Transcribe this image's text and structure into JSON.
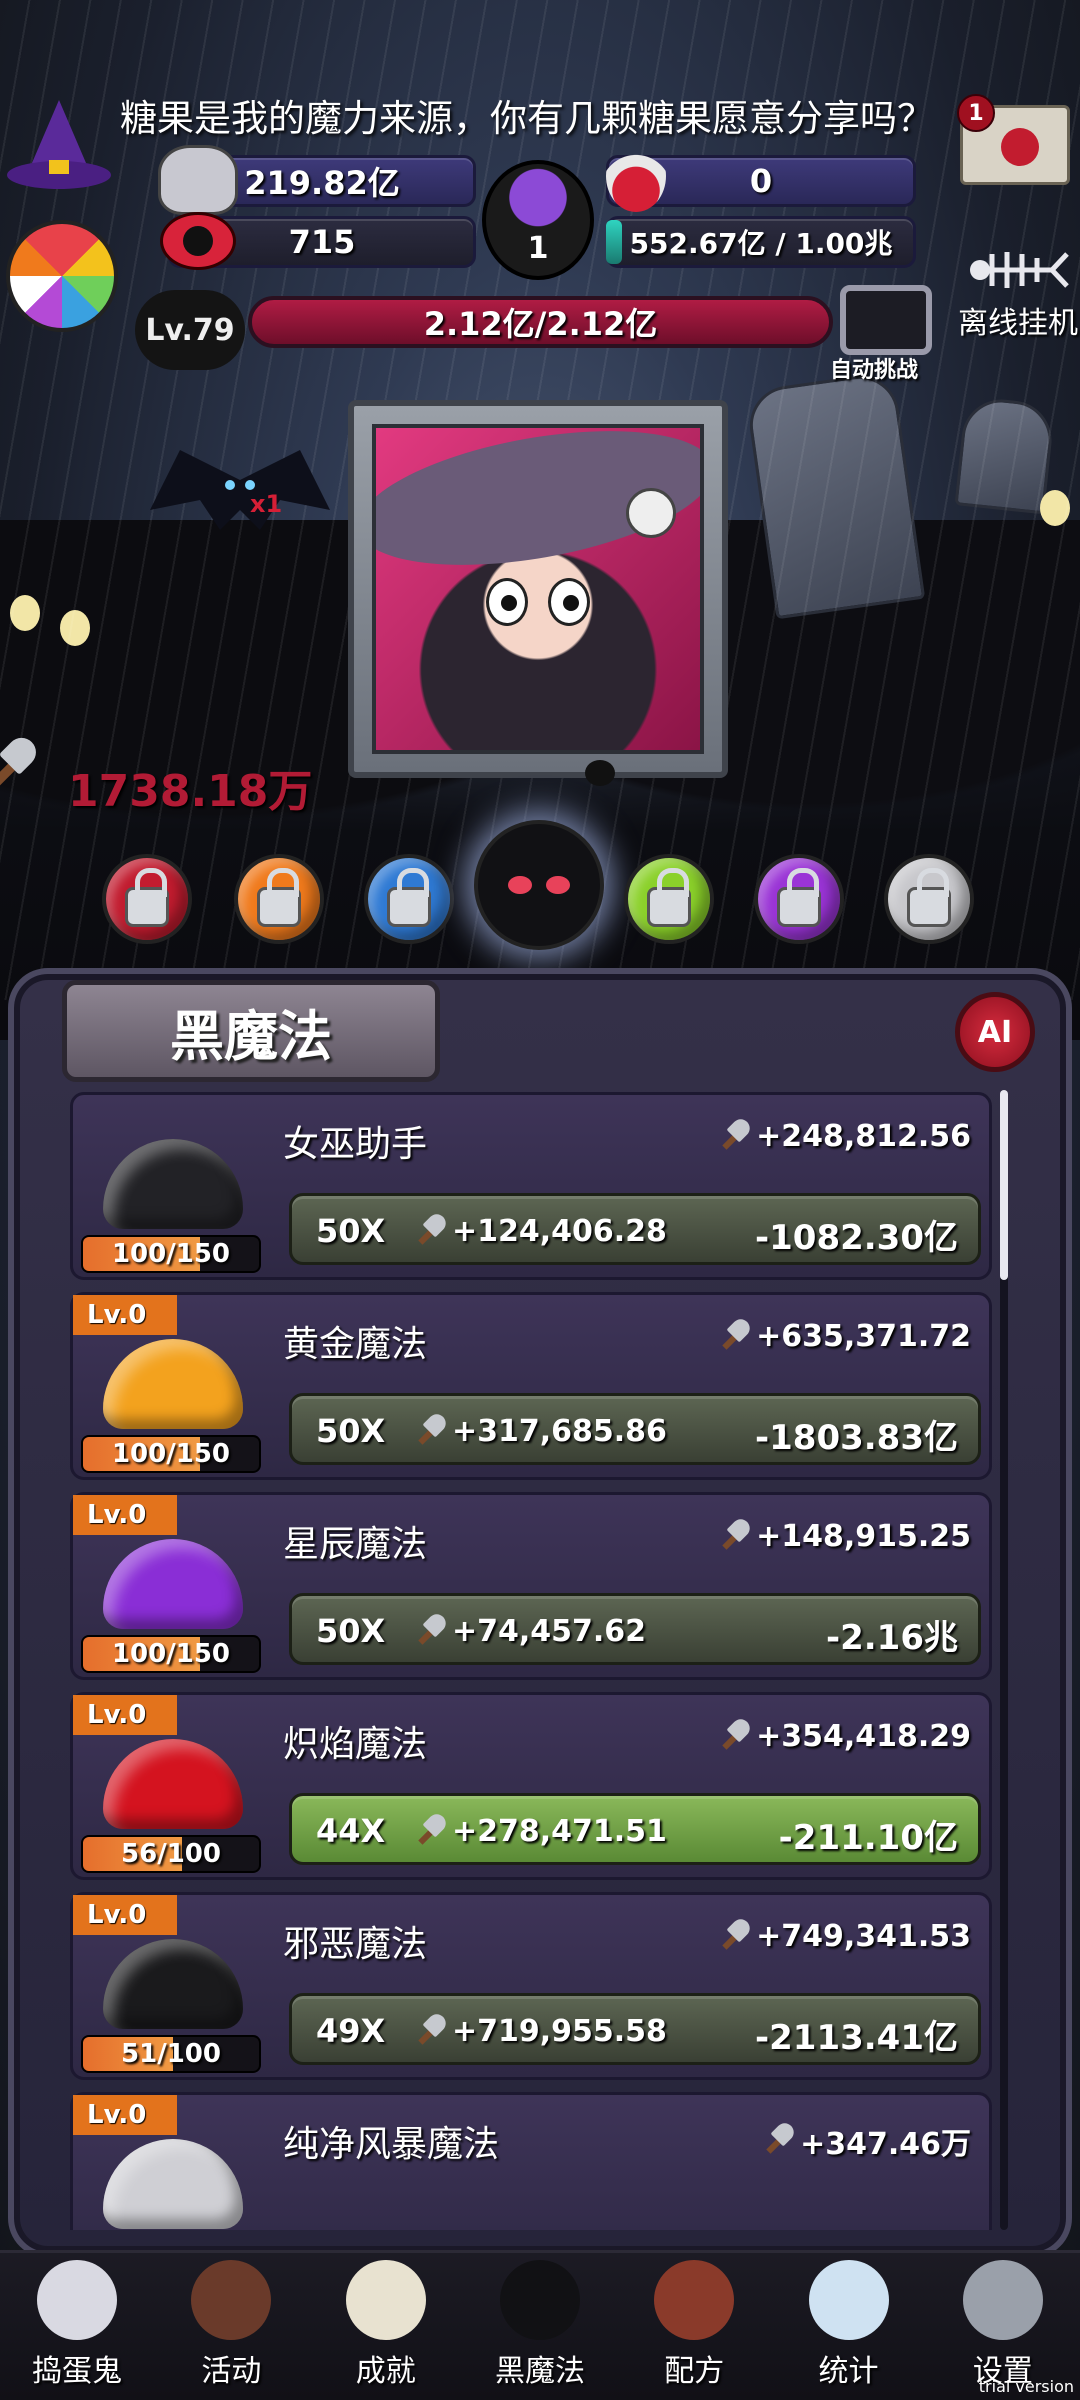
{
  "header": {
    "quest_text": "糖果是我的魔力来源，你有几颗糖果愿意分享吗？",
    "mail_count": "1",
    "candy_amount": "219.82亿",
    "ghost_amount": "0",
    "skull_amount": "715",
    "cauldron_count": "1",
    "potion_amount": "552.67亿 / 1.00兆",
    "level": "Lv.79",
    "hp": "2.12亿/2.12亿",
    "hp_fraction": 1.0,
    "auto_challenge": "自动挑战",
    "offline": "离线挂机"
  },
  "scene": {
    "damage": "1738.18万",
    "bat_multiplier": "x1"
  },
  "panel": {
    "title": "黑魔法",
    "ai_label": "AI"
  },
  "items": [
    {
      "name": "女巫助手",
      "lv": "",
      "progress": "100/150",
      "progress_fraction": 0.667,
      "rate": "+248,812.56",
      "mult": "50X",
      "gain": "+124,406.28",
      "cost": "-1082.30亿",
      "active": false,
      "color": "#222226"
    },
    {
      "name": "黄金魔法",
      "lv": "Lv.0",
      "progress": "100/150",
      "progress_fraction": 0.667,
      "rate": "+635,371.72",
      "mult": "50X",
      "gain": "+317,685.86",
      "cost": "-1803.83亿",
      "active": false,
      "color": "#f3a21e"
    },
    {
      "name": "星辰魔法",
      "lv": "Lv.0",
      "progress": "100/150",
      "progress_fraction": 0.667,
      "rate": "+148,915.25",
      "mult": "50X",
      "gain": "+74,457.62",
      "cost": "-2.16兆",
      "active": false,
      "color": "#8a2ed6"
    },
    {
      "name": "炽焰魔法",
      "lv": "Lv.0",
      "progress": "56/100",
      "progress_fraction": 0.56,
      "rate": "+354,418.29",
      "mult": "44X",
      "gain": "+278,471.51",
      "cost": "-211.10亿",
      "active": true,
      "color": "#d4131f"
    },
    {
      "name": "邪恶魔法",
      "lv": "Lv.0",
      "progress": "51/100",
      "progress_fraction": 0.51,
      "rate": "+749,341.53",
      "mult": "49X",
      "gain": "+719,955.58",
      "cost": "-2113.41亿",
      "active": false,
      "color": "#1a1a1c"
    },
    {
      "name": "纯净风暴魔法",
      "lv": "Lv.0",
      "progress": "",
      "progress_fraction": 0,
      "rate": "+347.46万",
      "mult": "",
      "gain": "",
      "cost": "",
      "active": false,
      "color": "#cfcfd4"
    }
  ],
  "orbs": [
    {
      "color": "#c21c2f"
    },
    {
      "color": "#f07a1c"
    },
    {
      "color": "#2f7ad4"
    },
    {
      "color": "#111114"
    },
    {
      "color": "#8bd12a"
    },
    {
      "color": "#9a34d6"
    },
    {
      "color": "#c8c8cc"
    }
  ],
  "nav": [
    {
      "label": "捣蛋鬼",
      "icon": "ghost-icon"
    },
    {
      "label": "活动",
      "icon": "cake-icon"
    },
    {
      "label": "成就",
      "icon": "trophy-skull-icon"
    },
    {
      "label": "黑魔法",
      "icon": "black-cat-icon"
    },
    {
      "label": "配方",
      "icon": "spellbook-icon"
    },
    {
      "label": "统计",
      "icon": "crystal-ball-icon"
    },
    {
      "label": "设置",
      "icon": "gear-icon"
    }
  ],
  "watermark": "trial version"
}
